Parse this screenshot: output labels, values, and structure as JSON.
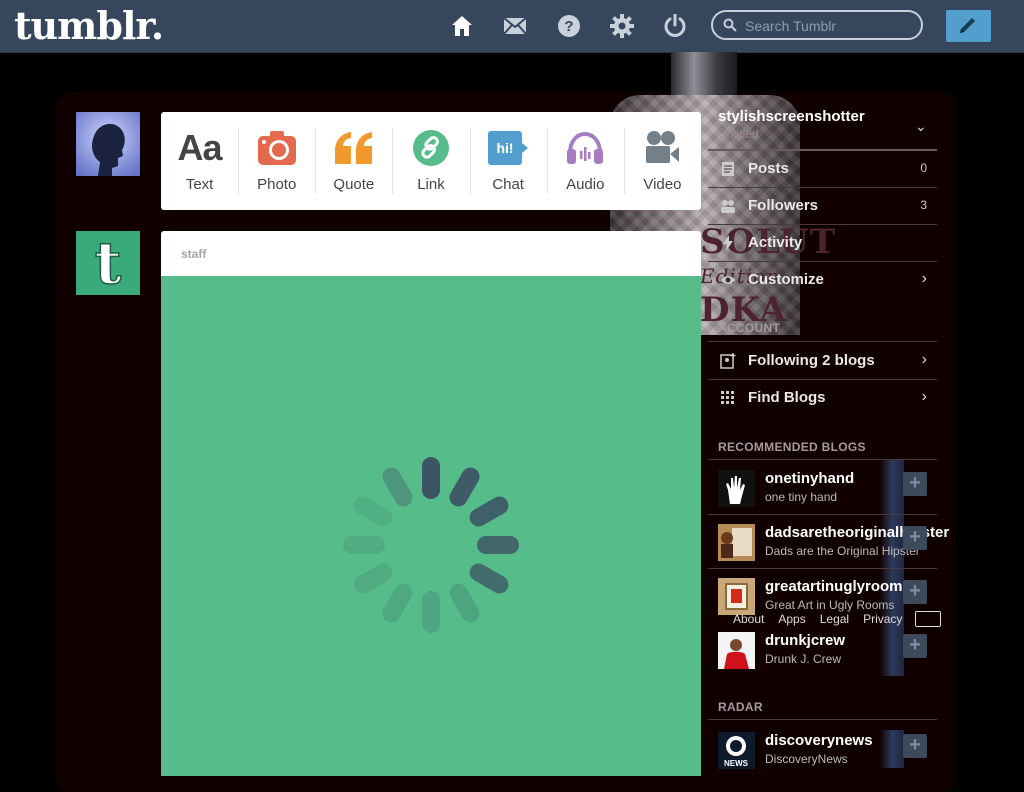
{
  "header": {
    "logo": "tumblr.",
    "search_placeholder": "Search Tumblr"
  },
  "composer": {
    "types": [
      {
        "label": "Text",
        "icon": "text-icon",
        "glyph": "Aa"
      },
      {
        "label": "Photo",
        "icon": "camera-icon"
      },
      {
        "label": "Quote",
        "icon": "quote-icon"
      },
      {
        "label": "Link",
        "icon": "link-icon"
      },
      {
        "label": "Chat",
        "icon": "chat-icon",
        "glyph": "hi!"
      },
      {
        "label": "Audio",
        "icon": "headphones-icon"
      },
      {
        "label": "Video",
        "icon": "video-camera-icon"
      }
    ]
  },
  "post": {
    "author": "staff",
    "background": "#56bc8a"
  },
  "bottle": {
    "line1": "SOLUT",
    "line2": "Edition",
    "line3": "DKA"
  },
  "sidebar": {
    "blog": {
      "name": "stylishscreenshotter",
      "subtitle": "Untitled"
    },
    "blog_items": [
      {
        "label": "Posts",
        "count": "0",
        "icon": "posts-icon"
      },
      {
        "label": "Followers",
        "count": "3",
        "icon": "followers-icon"
      },
      {
        "label": "Activity",
        "count": "",
        "icon": "activity-icon"
      },
      {
        "label": "Customize",
        "count": "",
        "icon": "eye-icon"
      }
    ],
    "account_heading": "ACCOUNT",
    "account_items": [
      {
        "label": "Following 2 blogs",
        "icon": "following-icon"
      },
      {
        "label": "Find Blogs",
        "icon": "find-blogs-icon"
      }
    ],
    "recommended_heading": "RECOMMENDED BLOGS",
    "recommended": [
      {
        "name": "onetinyhand",
        "desc": "one tiny hand"
      },
      {
        "name": "dadsaretheoriginalhipster",
        "desc": "Dads are the Original Hipster"
      },
      {
        "name": "greatartinuglyrooms",
        "desc": "Great Art in Ugly Rooms"
      },
      {
        "name": "drunkjcrew",
        "desc": "Drunk J. Crew"
      }
    ],
    "footer_links": [
      "About",
      "Apps",
      "Legal",
      "Privacy"
    ],
    "radar_heading": "RADAR",
    "radar": {
      "name": "discoverynews",
      "desc": "DiscoveryNews",
      "badge": "NEWS"
    }
  },
  "colors": {
    "header_bg": "#36465d",
    "compose_bg": "#529ecc",
    "photo": "#e46a4e",
    "quote": "#f2992e",
    "link": "#56bc8a",
    "chat": "#529ecc",
    "audio": "#a77dc2",
    "video": "#748089",
    "post_bg": "#56bc8a"
  }
}
